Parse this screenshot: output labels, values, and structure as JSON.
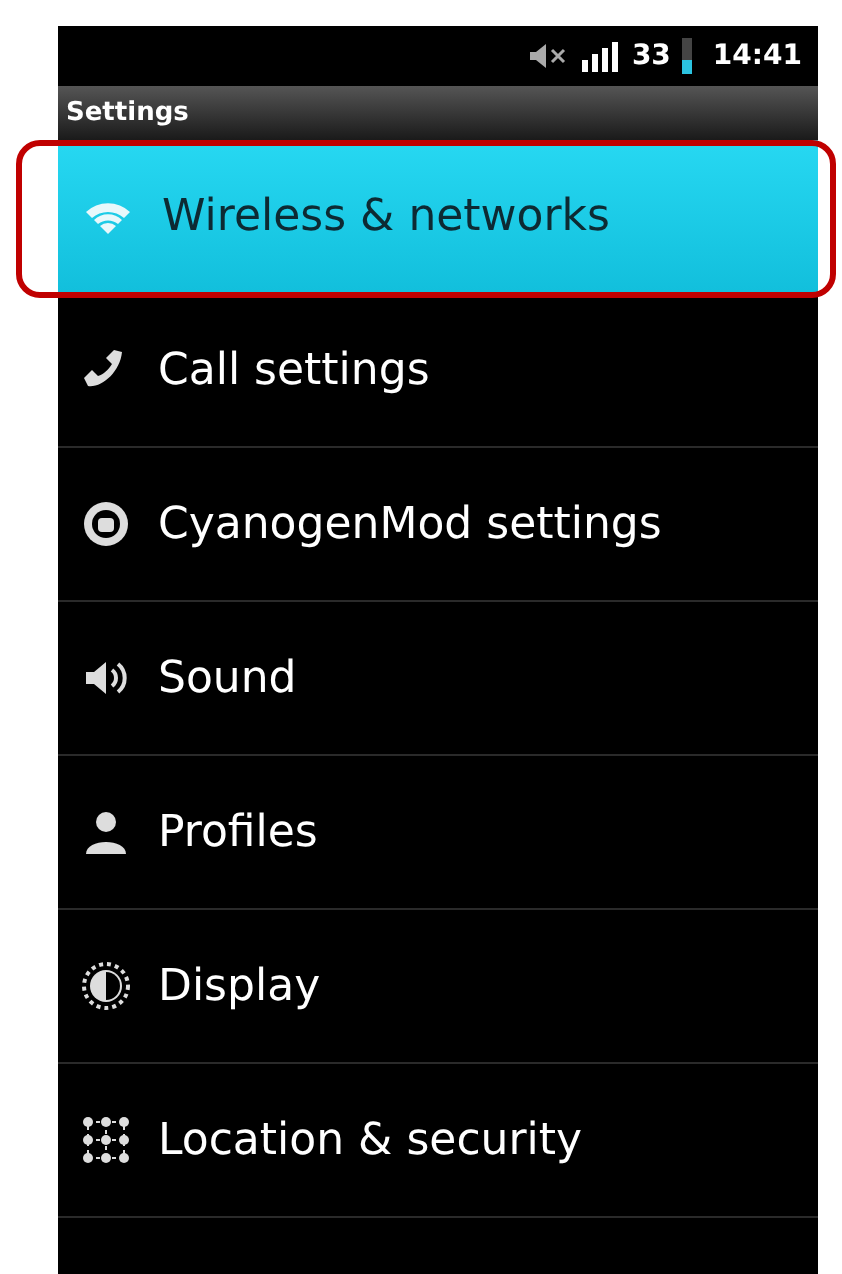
{
  "status_bar": {
    "battery": "33",
    "time": "14:41"
  },
  "title": "Settings",
  "items": [
    {
      "label": "Wireless & networks",
      "selected": true
    },
    {
      "label": "Call settings",
      "selected": false
    },
    {
      "label": "CyanogenMod settings",
      "selected": false
    },
    {
      "label": "Sound",
      "selected": false
    },
    {
      "label": "Profiles",
      "selected": false
    },
    {
      "label": "Display",
      "selected": false
    },
    {
      "label": "Location & security",
      "selected": false
    }
  ]
}
